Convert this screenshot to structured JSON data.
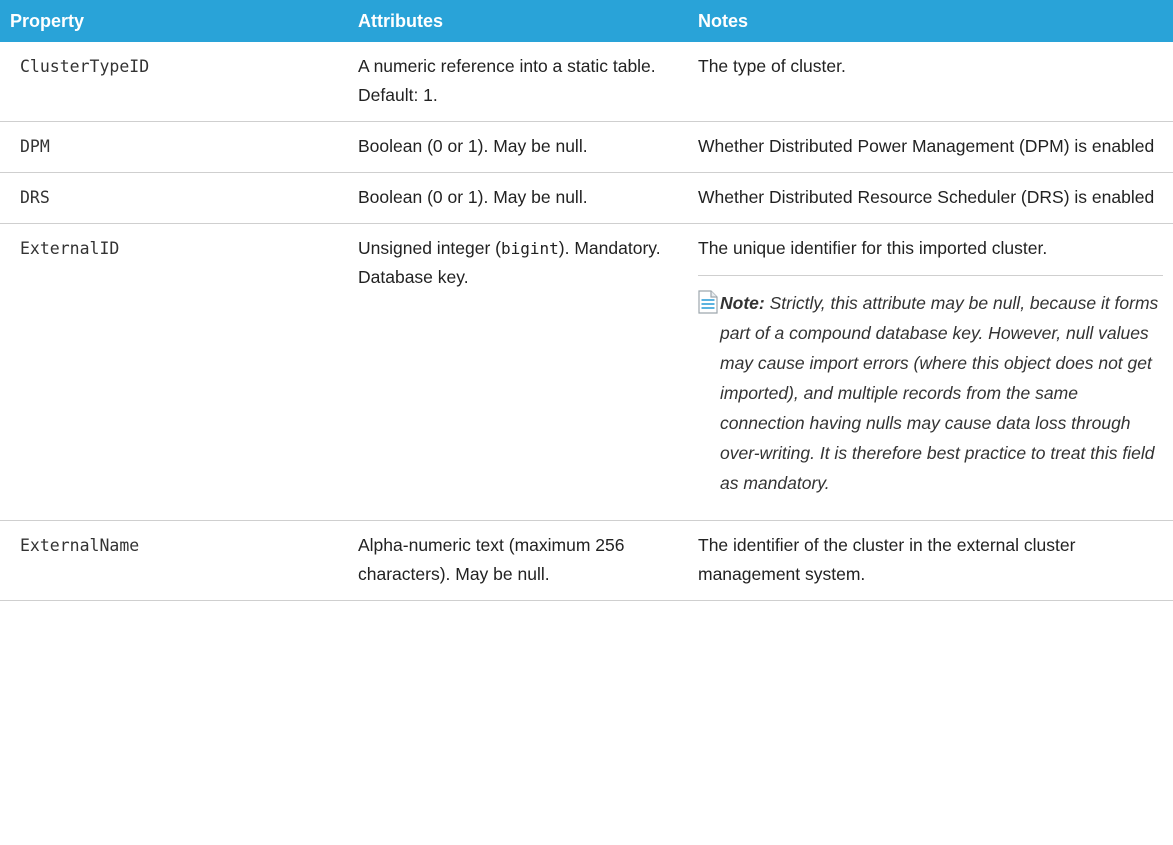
{
  "headers": {
    "property": "Property",
    "attributes": "Attributes",
    "notes": "Notes"
  },
  "rows": [
    {
      "property": "ClusterTypeID",
      "attributes": "A numeric reference into a static table. Default: 1.",
      "notes": "The type of cluster."
    },
    {
      "property": "DPM",
      "attributes": "Boolean (0 or 1). May be null.",
      "notes": "Whether Distributed Power Management (DPM) is enabled"
    },
    {
      "property": "DRS",
      "attributes": "Boolean (0 or 1). May be null.",
      "notes": "Whether Distributed Resource Scheduler (DRS) is enabled"
    },
    {
      "property": "ExternalID",
      "attributes_before": "Unsigned integer (",
      "attributes_code": "bigint",
      "attributes_after": "). Mandatory. Database key.",
      "notes": "The unique identifier for this imported cluster.",
      "note_label": "Note:",
      "note_text": "Strictly, this attribute may be null, because it forms part of a compound database key. However, null values may cause import errors (where this object does not get imported), and multiple records from the same connection having nulls may cause data loss through over-writing. It is therefore best practice to treat this field as mandatory."
    },
    {
      "property": "ExternalName",
      "attributes": "Alpha-numeric text (maximum 256 characters). May be null.",
      "notes": "The identifier of the cluster in the external cluster management system."
    }
  ],
  "colors": {
    "header_bg": "#29a3d8",
    "header_text": "#ffffff",
    "row_divider": "#cfcfcf",
    "note_icon": "#5bb3e0"
  },
  "icons": {
    "note": "note-icon"
  }
}
